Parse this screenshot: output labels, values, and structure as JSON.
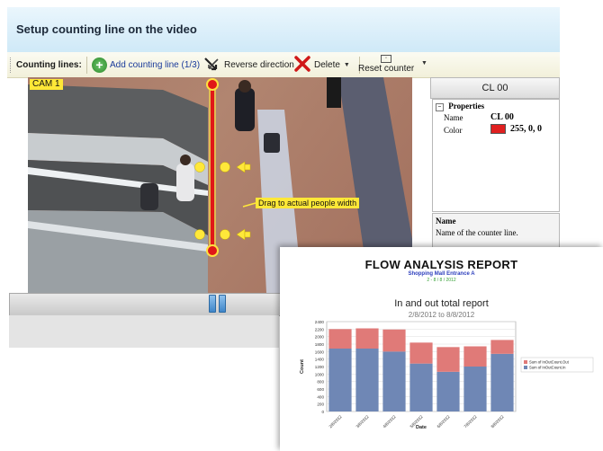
{
  "header": {
    "title": "Setup counting line on the video"
  },
  "toolbar": {
    "label": "Counting lines:",
    "add": "Add counting line (1/3)",
    "reverse": "Reverse direction",
    "delete": "Delete",
    "reset": "Reset counter"
  },
  "video": {
    "camera": "CAM 1",
    "hint": "Drag to actual people width"
  },
  "properties": {
    "header": "CL 00",
    "group": "Properties",
    "name_key": "Name",
    "name_value": "CL 00",
    "color_key": "Color",
    "color_value": "255, 0, 0",
    "color_swatch": "#e02020",
    "desc_title": "Name",
    "desc_text": "Name of the counter line."
  },
  "report": {
    "title": "FLOW ANALYSIS REPORT",
    "subtitle": "Shopping Mall Entrance A",
    "date_range": "2 - 8 / 8 / 2012",
    "chart_title": "In and out total report",
    "chart_range": "2/8/2012 to 8/8/2012"
  },
  "chart_data": {
    "type": "bar",
    "stacked": true,
    "categories": [
      "2/8/2012",
      "3/8/2012",
      "4/8/2012",
      "5/8/2012",
      "6/8/2012",
      "7/8/2012",
      "8/8/2012"
    ],
    "series": [
      {
        "name": "Sum of InOutCount.In",
        "color": "#6f87b5",
        "values": [
          1680,
          1680,
          1600,
          1280,
          1060,
          1200,
          1540
        ]
      },
      {
        "name": "Sum of InOutCount.Out",
        "color": "#e07a78",
        "values": [
          520,
          540,
          590,
          560,
          660,
          540,
          370
        ]
      }
    ],
    "xlabel": "Date",
    "ylabel": "Count",
    "ylim": [
      0,
      2400
    ],
    "yticks": [
      0,
      200,
      400,
      600,
      800,
      1000,
      1200,
      1400,
      1600,
      1800,
      2000,
      2200,
      2400
    ],
    "grid": true,
    "legend": "right"
  }
}
